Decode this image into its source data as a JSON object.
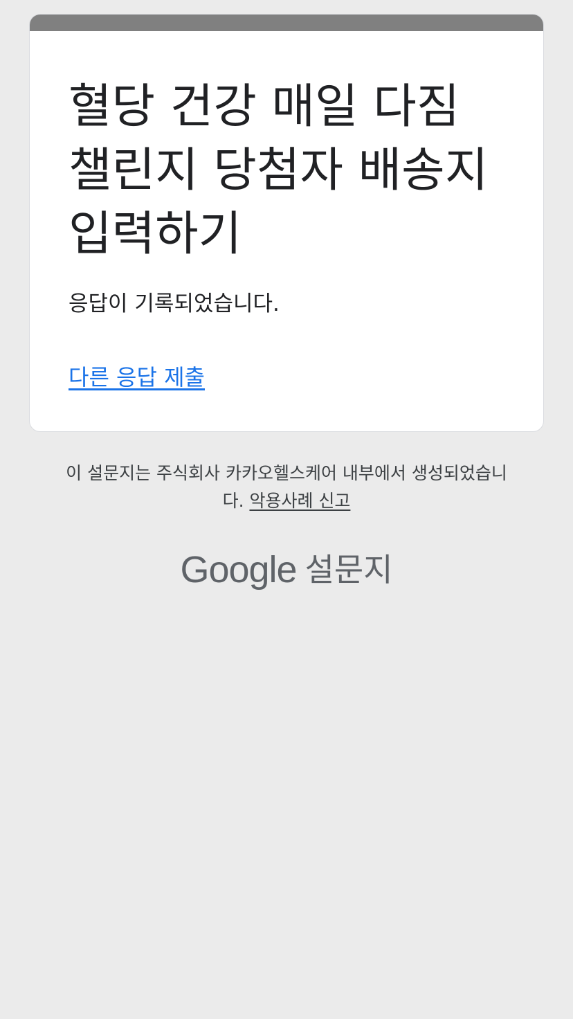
{
  "form": {
    "title": "혈당 건강 매일 다짐 챌린지 당첨자 배송지 입력하기",
    "confirmation": "응답이 기록되었습니다.",
    "resubmit_link": "다른 응답 제출"
  },
  "footer": {
    "note": "이 설문지는 주식회사 카카오헬스케어 내부에서 생성되었습니다.",
    "abuse_link": "악용사례 신고"
  },
  "brand": {
    "google": "Google",
    "product": "설문지"
  },
  "colors": {
    "page_background": "#ebebeb",
    "card_top_bar": "#808080",
    "link": "#1a73e8",
    "text": "#202124"
  }
}
